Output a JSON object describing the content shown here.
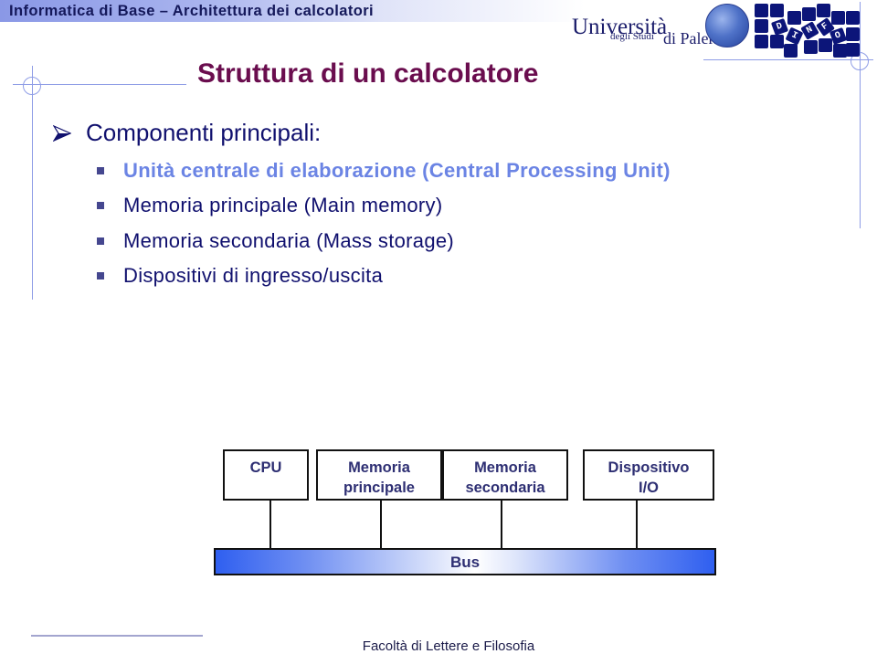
{
  "header": {
    "course_title": "Informatica di Base – Architettura dei calcolatori"
  },
  "logos": {
    "university_line1": "Università",
    "university_line2": "degli Studi",
    "university_line3": "di Palermo",
    "dinfo_letters": [
      "D",
      "I",
      "N",
      "F",
      "O"
    ]
  },
  "slide": {
    "title": "Struttura di un calcolatore",
    "main_bullet": "Componenti principali:",
    "sub_items": [
      {
        "label": "Unità centrale di elaborazione (Central Processing Unit)",
        "highlighted": true
      },
      {
        "label": "Memoria principale (Main memory)",
        "highlighted": false
      },
      {
        "label": "Memoria secondaria (Mass storage)",
        "highlighted": false
      },
      {
        "label": "Dispositivi di ingresso/uscita",
        "highlighted": false
      }
    ]
  },
  "diagram": {
    "components": [
      {
        "line1": "CPU",
        "line2": ""
      },
      {
        "line1": "Memoria",
        "line2": "principale"
      },
      {
        "line1": "Memoria",
        "line2": "secondaria"
      },
      {
        "line1": "Dispositivo",
        "line2": "I/O"
      }
    ],
    "bus_label": "Bus"
  },
  "footer": {
    "faculty": "Facoltà di Lettere e Filosofia"
  },
  "colors": {
    "title": "#6a0d4e",
    "body_text": "#10106e",
    "highlight_text": "#6b84e4",
    "accent_lines": "#8f9de6"
  }
}
